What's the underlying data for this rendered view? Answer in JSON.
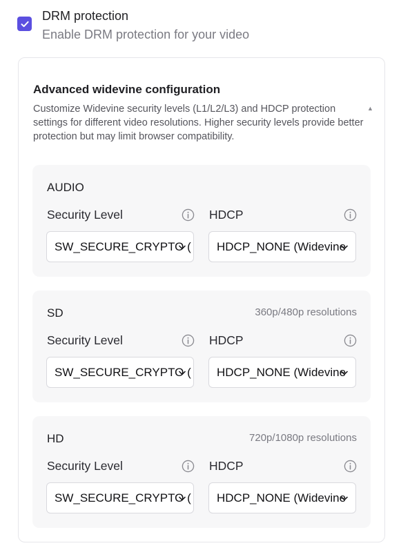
{
  "drm": {
    "checked": true,
    "title": "DRM protection",
    "description": "Enable DRM protection for your video",
    "accent_color": "#5b4fe0"
  },
  "config": {
    "title": "Advanced widevine configuration",
    "description": "Customize Widevine security levels (L1/L2/L3) and HDCP protection settings for different video resolutions. Higher security levels provide better protection but may limit browser compatibility."
  },
  "field_labels": {
    "security_level": "Security Level",
    "hdcp": "HDCP"
  },
  "sections": [
    {
      "name": "AUDIO",
      "note": "",
      "security_level_value": "SW_SECURE_CRYPTO (",
      "hdcp_value": "HDCP_NONE (Widevine"
    },
    {
      "name": "SD",
      "note": "360p/480p resolutions",
      "security_level_value": "SW_SECURE_CRYPTO (",
      "hdcp_value": "HDCP_NONE (Widevine"
    },
    {
      "name": "HD",
      "note": "720p/1080p resolutions",
      "security_level_value": "SW_SECURE_CRYPTO (",
      "hdcp_value": "HDCP_NONE (Widevine"
    }
  ],
  "icons": {
    "checkbox": "check-icon",
    "info": "info-icon",
    "dropdown": "chevron-down-icon"
  }
}
